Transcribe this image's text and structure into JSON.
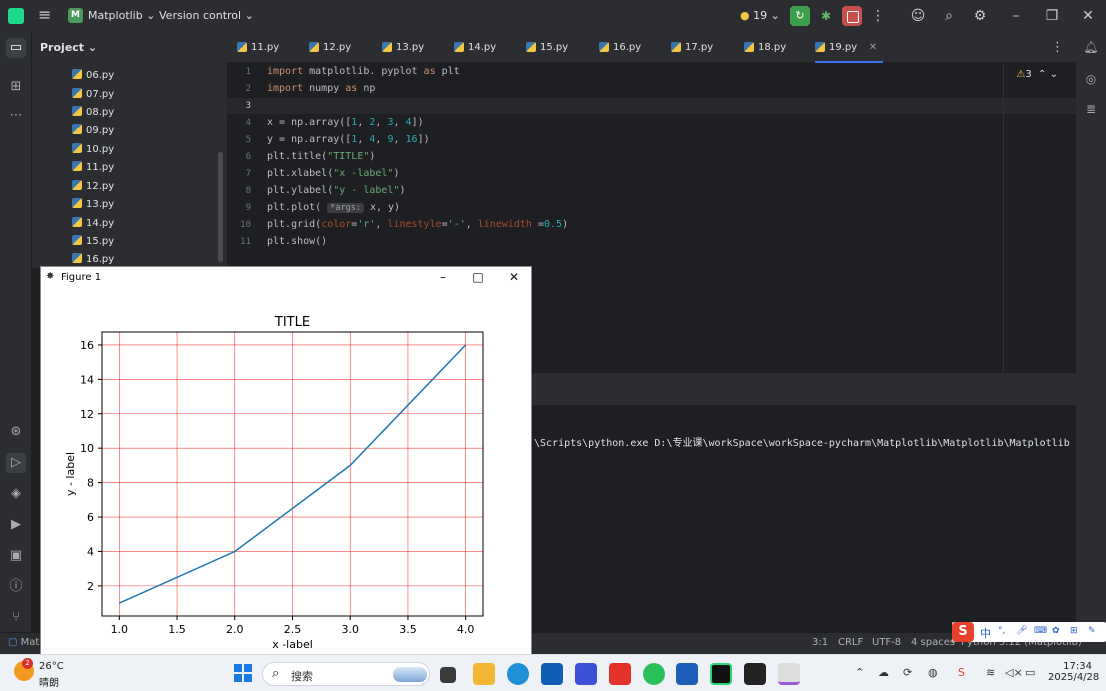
{
  "topbar": {
    "project_badge": "M",
    "project_name": "Matplotlib",
    "version_control": "Version control",
    "run_count": "19"
  },
  "project_panel": {
    "header": "Project",
    "files": [
      "06.py",
      "07.py",
      "08.py",
      "09.py",
      "10.py",
      "11.py",
      "12.py",
      "13.py",
      "14.py",
      "15.py",
      "16.py"
    ]
  },
  "tabs": [
    "11.py",
    "12.py",
    "13.py",
    "14.py",
    "15.py",
    "16.py",
    "17.py",
    "18.py",
    "19.py"
  ],
  "active_tab": "19.py",
  "editor": {
    "warnings": "3",
    "line_numbers": [
      "1",
      "2",
      "3",
      "4",
      "5",
      "6",
      "7",
      "8",
      "9",
      "10",
      "11"
    ],
    "inlay_hint": "*args:"
  },
  "run_output": {
    "command": "\\Scripts\\python.exe D:\\专业课\\workSpace\\workSpace-pycharm\\Matplotlib\\Matplotlib\\Matplotlib"
  },
  "status_bar": {
    "left": "Matp",
    "position": "3:1",
    "line_sep": "CRLF",
    "encoding": "UTF-8",
    "indent": "4 spaces",
    "interpreter": "Python 3.12 (Matplotlib)"
  },
  "ime": {
    "mode": "中"
  },
  "figure_window": {
    "title": "Figure 1"
  },
  "chart_data": {
    "type": "line",
    "title": "TITLE",
    "xlabel": "x -label",
    "ylabel": "y - label",
    "x": [
      1,
      2,
      3,
      4
    ],
    "y": [
      1,
      4,
      9,
      16
    ],
    "xticks": [
      "1.0",
      "1.5",
      "2.0",
      "2.5",
      "3.0",
      "3.5",
      "4.0"
    ],
    "yticks": [
      "2",
      "4",
      "6",
      "8",
      "10",
      "12",
      "14",
      "16"
    ],
    "xlim": [
      0.85,
      4.15
    ],
    "ylim": [
      0.25,
      16.75
    ],
    "grid": true,
    "grid_color": "#ff0000",
    "line_color": "#1f77b4"
  },
  "taskbar": {
    "weather_badge": "2",
    "temperature": "26°C",
    "weather": "晴朗",
    "search_placeholder": "搜索",
    "time": "17:34",
    "date": "2025/4/28"
  }
}
